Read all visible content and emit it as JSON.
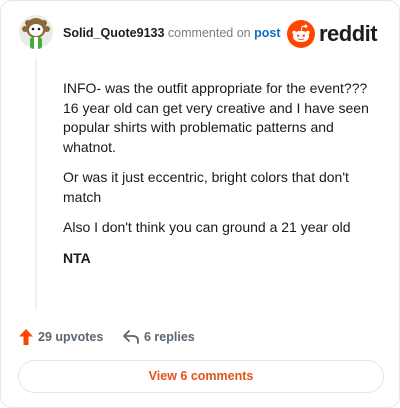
{
  "header": {
    "username": "Solid_Quote9133",
    "action_text": "commented on",
    "post_link": "post",
    "logo_text": "reddit",
    "brand_color": "#ff4500"
  },
  "comment": {
    "paragraphs": [
      "INFO- was the outfit appropriate for the event??? 16 year old can get very creative and I have seen popular shirts with problematic patterns and whatnot.",
      "Or was it just eccentric, bright colors that don't match",
      "Also I don't think you can ground a 21 year old",
      "NTA"
    ]
  },
  "actions": {
    "upvotes": "29 upvotes",
    "replies": "6 replies",
    "upvote_color": "#ff4500"
  },
  "footer": {
    "view_button": "View 6 comments",
    "button_color": "#e0541a"
  },
  "icons": {
    "avatar": "avatar",
    "logo": "reddit-snoo-icon",
    "upvote": "upvote-arrow-icon",
    "reply": "reply-arrow-icon"
  }
}
